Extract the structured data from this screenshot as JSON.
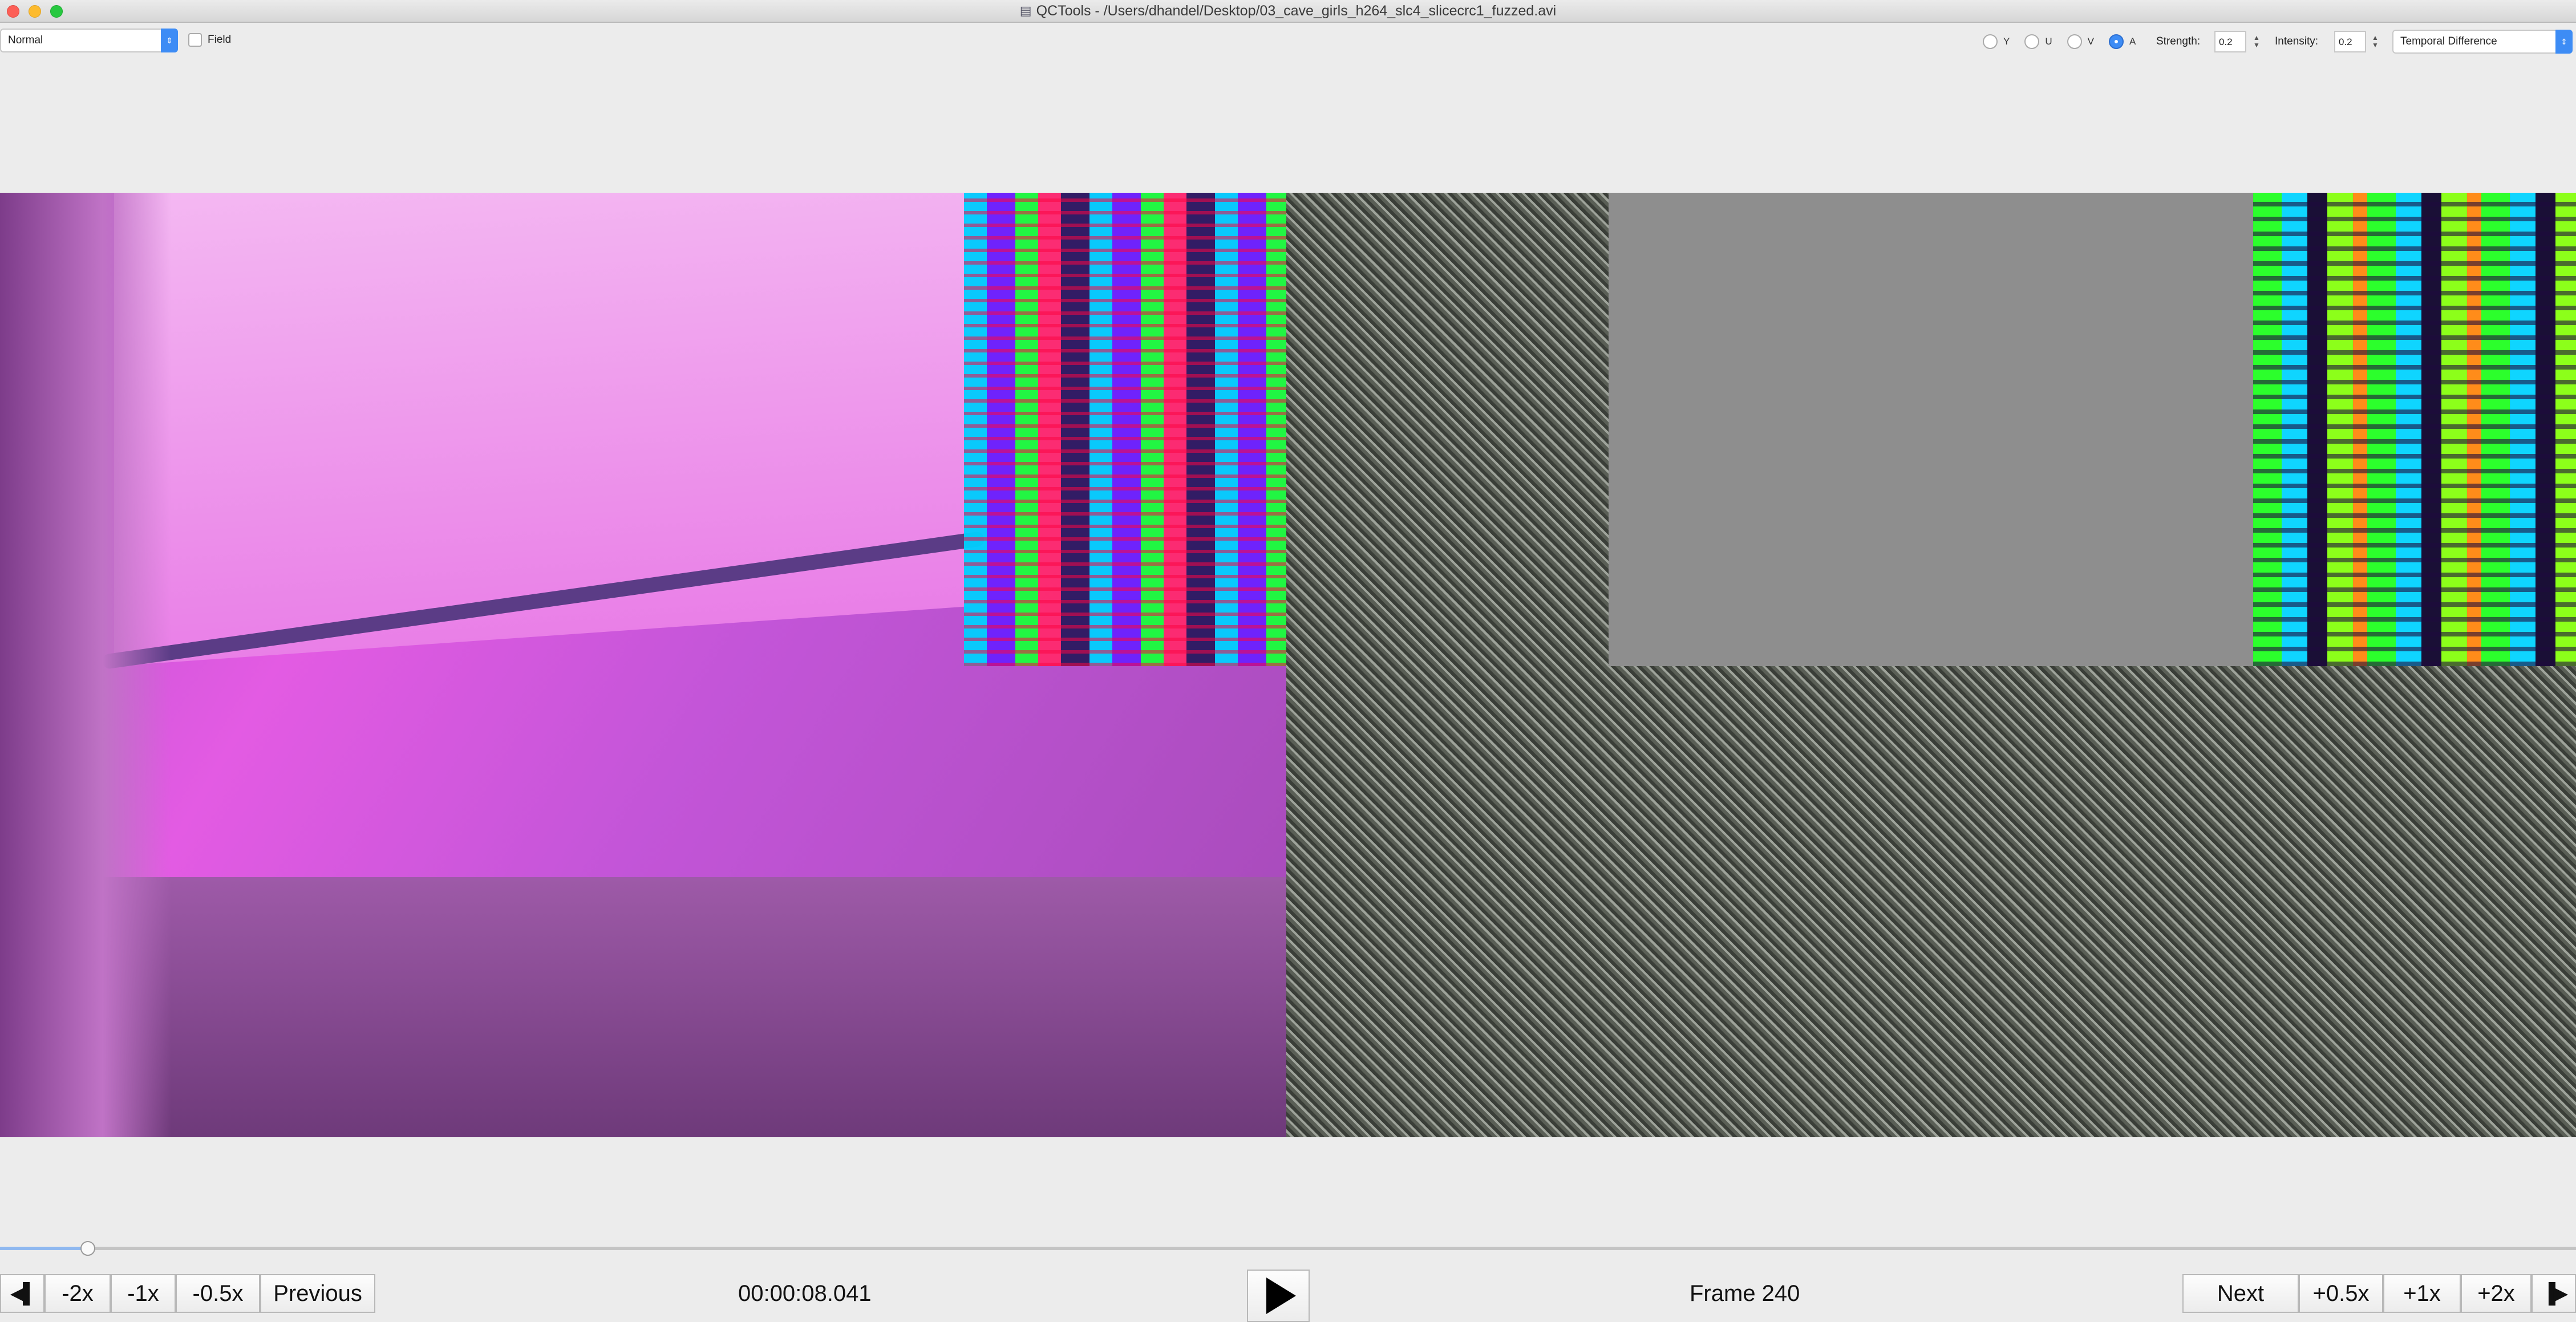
{
  "window": {
    "title": "QCTools - /Users/dhandel/Desktop/03_cave_girls_h264_slc4_slicecrc1_fuzzed.avi"
  },
  "toolbar": {
    "mode_select": "Normal",
    "field_label": "Field",
    "field_checked": false,
    "radios": [
      {
        "label": "Y",
        "selected": false
      },
      {
        "label": "U",
        "selected": false
      },
      {
        "label": "V",
        "selected": false
      },
      {
        "label": "A",
        "selected": true
      }
    ],
    "strength_label": "Strength:",
    "strength_value": "0.2",
    "intensity_label": "Intensity:",
    "intensity_value": "0.2",
    "filter_select": "Temporal Difference"
  },
  "playback": {
    "position_fraction": 0.034,
    "timecode": "00:00:08.041",
    "frame_label": "Frame 240",
    "buttons": {
      "step_back_icon": "step-back-icon",
      "minus_2x": "-2x",
      "minus_1x": "-1x",
      "minus_05x": "-0.5x",
      "previous": "Previous",
      "play_icon": "play-icon",
      "next": "Next",
      "plus_05x": "+0.5x",
      "plus_1x": "+1x",
      "plus_2x": "+2x",
      "step_forward_icon": "step-forward-icon"
    }
  },
  "colors": {
    "accent": "#3d8cf5"
  }
}
